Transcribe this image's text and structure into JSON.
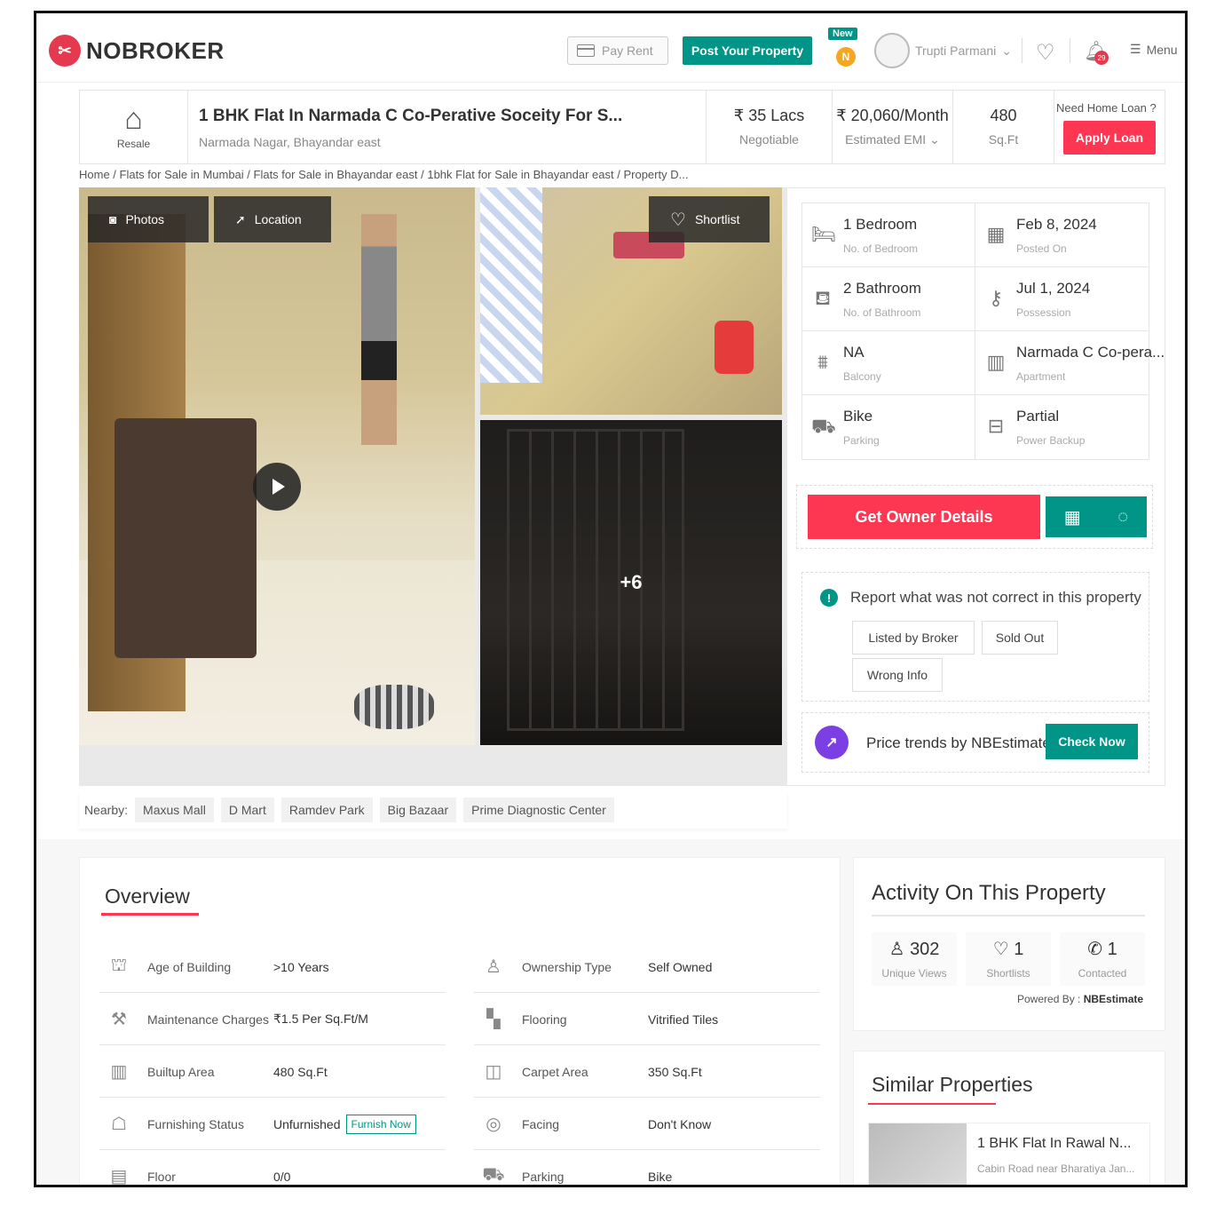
{
  "header": {
    "logo_text": "NOBROKER",
    "pay_rent": "Pay Rent",
    "post_property": "Post Your Property",
    "new_badge": "New",
    "coin_label": "N",
    "user_name": "Trupti Parmani",
    "notification_count": "29",
    "menu_label": "Menu"
  },
  "title_bar": {
    "type_label": "Resale",
    "title": "1 BHK Flat In Narmada C Co-Perative Soceity For S...",
    "address": "Narmada Nagar, Bhayandar east",
    "price": "₹ 35 Lacs",
    "price_sub": "Negotiable",
    "emi": "₹ 20,060/Month",
    "emi_sub": "Estimated EMI",
    "area": "480",
    "area_sub": "Sq.Ft",
    "loan_question": "Need Home Loan ?",
    "apply_loan": "Apply Loan"
  },
  "breadcrumb": "Home / Flats for Sale in Mumbai / Flats for Sale in Bhayandar east / 1bhk Flat for Sale in Bhayandar east / Property D...",
  "gallery": {
    "photos_label": "Photos",
    "location_label": "Location",
    "shortlist_label": "Shortlist",
    "more_count": "+6"
  },
  "nearby": {
    "label": "Nearby:",
    "places": [
      "Maxus Mall",
      "D Mart",
      "Ramdev Park",
      "Big Bazaar",
      "Prime Diagnostic Center"
    ]
  },
  "details": [
    {
      "value": "1 Bedroom",
      "label": "No. of Bedroom",
      "icon": "bed-icon"
    },
    {
      "value": "Feb 8, 2024",
      "label": "Posted On",
      "icon": "calendar-icon"
    },
    {
      "value": "2 Bathroom",
      "label": "No. of Bathroom",
      "icon": "bathtub-icon"
    },
    {
      "value": "Jul 1, 2024",
      "label": "Possession",
      "icon": "key-icon"
    },
    {
      "value": "NA",
      "label": "Balcony",
      "icon": "balcony-icon"
    },
    {
      "value": "Narmada C Co-pera...",
      "label": "Apartment",
      "icon": "building-icon"
    },
    {
      "value": "Bike",
      "label": "Parking",
      "icon": "car-icon"
    },
    {
      "value": "Partial",
      "label": "Power Backup",
      "icon": "battery-icon"
    }
  ],
  "cta": {
    "owner_details": "Get Owner Details"
  },
  "report": {
    "heading": "Report what was not correct in this property",
    "options": [
      "Listed by Broker",
      "Sold Out",
      "Wrong Info"
    ]
  },
  "trend": {
    "text": "Price trends by NBEstimate",
    "button": "Check Now"
  },
  "overview": {
    "title": "Overview",
    "left": [
      {
        "label": "Age of Building",
        "value": ">10 Years",
        "icon": "cake-icon"
      },
      {
        "label": "Maintenance Charges",
        "value": "₹1.5 Per Sq.Ft/M",
        "icon": "tools-icon"
      },
      {
        "label": "Builtup Area",
        "value": "480 Sq.Ft",
        "icon": "building-icon"
      },
      {
        "label": "Furnishing Status",
        "value": "Unfurnished",
        "icon": "sofa-icon"
      },
      {
        "label": "Floor",
        "value": "0/0",
        "icon": "floor-icon"
      }
    ],
    "furnish_now": "Furnish Now",
    "right": [
      {
        "label": "Ownership Type",
        "value": "Self Owned",
        "icon": "owner-icon"
      },
      {
        "label": "Flooring",
        "value": "Vitrified Tiles",
        "icon": "tiles-icon"
      },
      {
        "label": "Carpet Area",
        "value": "350 Sq.Ft",
        "icon": "carpet-icon"
      },
      {
        "label": "Facing",
        "value": "Don't Know",
        "icon": "compass-icon"
      },
      {
        "label": "Parking",
        "value": "Bike",
        "icon": "car-icon"
      }
    ]
  },
  "activity": {
    "title": "Activity On This Property",
    "stats": [
      {
        "value": "302",
        "label": "Unique Views",
        "icon": "user-icon"
      },
      {
        "value": "1",
        "label": "Shortlists",
        "icon": "heart-icon"
      },
      {
        "value": "1",
        "label": "Contacted",
        "icon": "phone-icon"
      }
    ],
    "powered_label": "Powered By :",
    "powered_brand": "NBEstimate"
  },
  "similar": {
    "title": "Similar Properties",
    "card_title": "1 BHK Flat In Rawal N...",
    "card_address": "Cabin Road near Bharatiya Jan..."
  }
}
